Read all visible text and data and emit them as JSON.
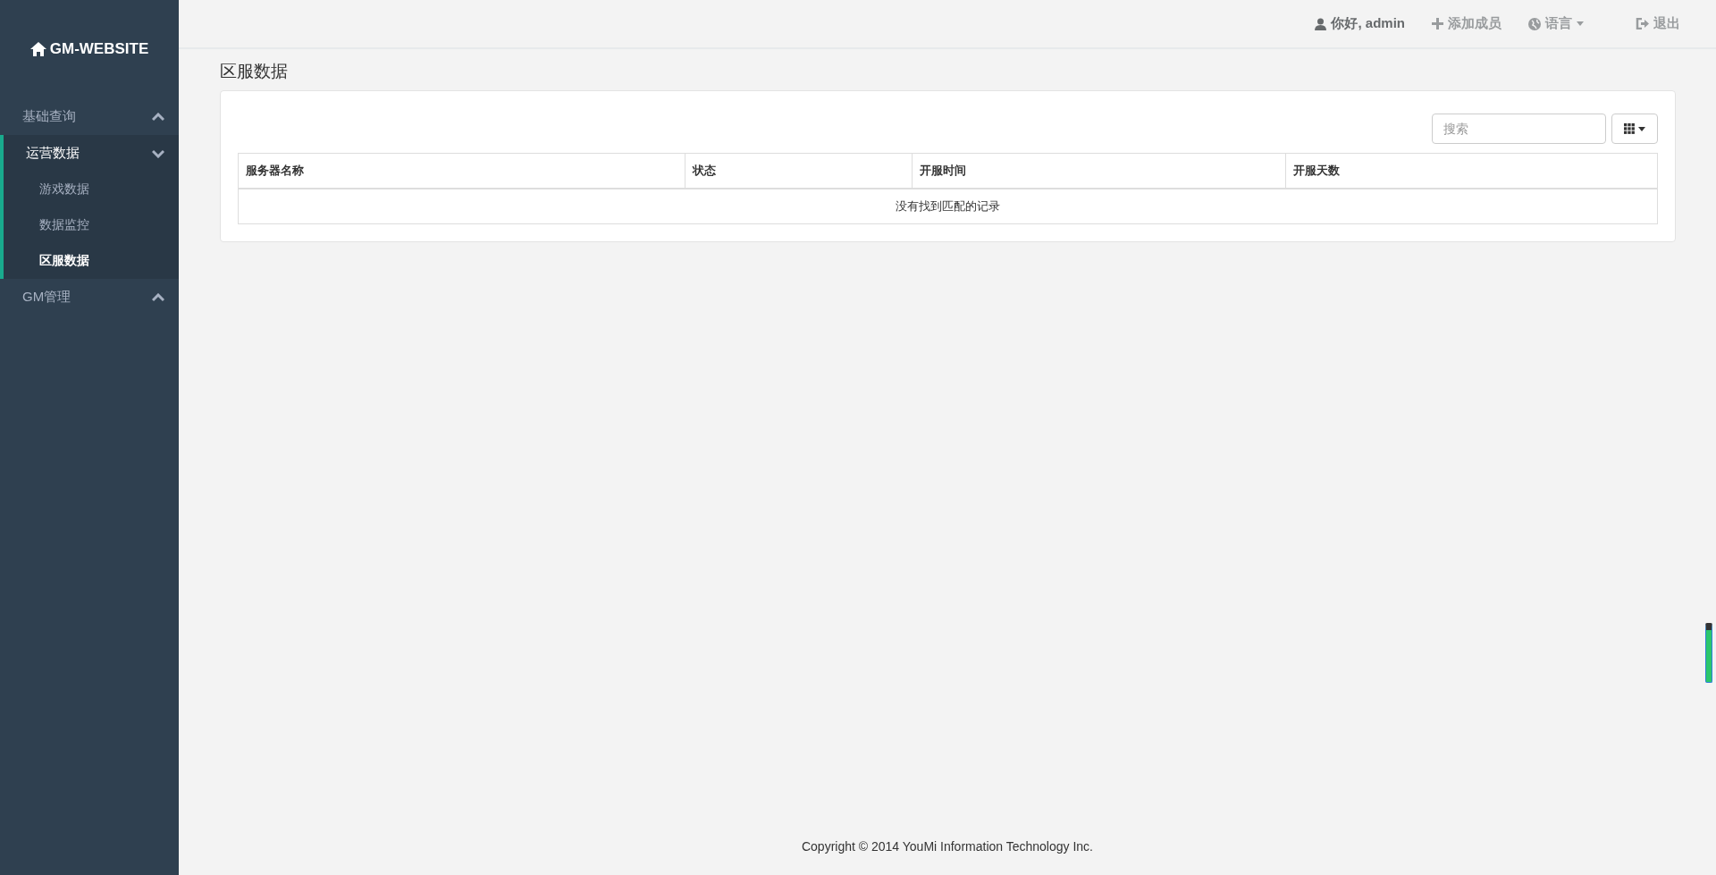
{
  "brand": {
    "title": "GM-WEBSITE"
  },
  "sidebar": {
    "items": [
      {
        "label": "基础查询",
        "expanded": false
      },
      {
        "label": "运营数据",
        "expanded": true,
        "children": [
          {
            "label": "游戏数据",
            "selected": false
          },
          {
            "label": "数据监控",
            "selected": false
          },
          {
            "label": "区服数据",
            "selected": true
          }
        ]
      },
      {
        "label": "GM管理",
        "expanded": false
      }
    ]
  },
  "topbar": {
    "items": [
      {
        "kind": "user",
        "label": "你好, admin"
      },
      {
        "kind": "add",
        "label": "添加成员"
      },
      {
        "kind": "language",
        "label": "语言"
      },
      {
        "kind": "logout",
        "label": "退出"
      }
    ]
  },
  "page_title": "区服数据",
  "search": {
    "placeholder": "搜索"
  },
  "table": {
    "columns": [
      "服务器名称",
      "状态",
      "开服时间",
      "开服天数"
    ],
    "empty_message": "没有找到匹配的记录"
  },
  "footer": "Copyright © 2014 YouMi Information Technology Inc."
}
